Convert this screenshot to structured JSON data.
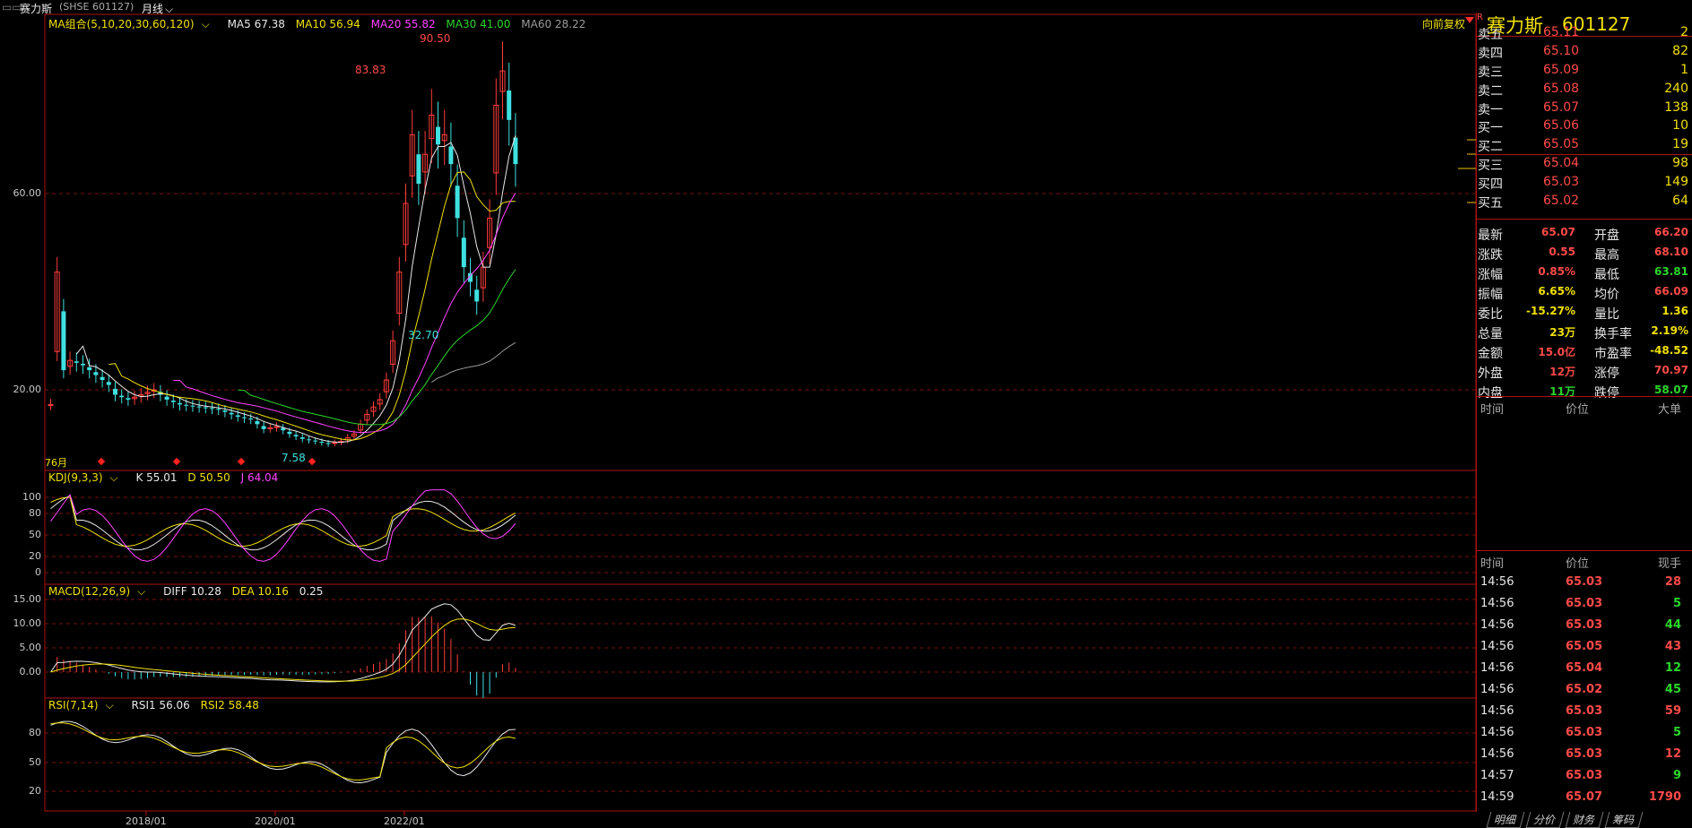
{
  "top_bar": {
    "stock_label": "赛力斯",
    "code_label": "(SHSE 601127)",
    "period": "月线"
  },
  "main_chart": {
    "ma_combo": "MA组合(5,10,20,30,60,120)",
    "ma5": "MA5 67.38",
    "ma10": "MA10 56.94",
    "ma20": "MA20 55.82",
    "ma30": "MA30 41.00",
    "ma60": "MA60 28.22",
    "adjust": "向前复权",
    "y_labels": [
      "60.00",
      "20.00"
    ],
    "high1": "83.83",
    "high2": "90.50",
    "low1": "7.58",
    "low2": "32.70",
    "months": "76月",
    "colors": {
      "ma5": "#e8e8e8",
      "ma10": "#f0e000",
      "ma20": "#ff44ff",
      "ma30": "#2bd62b",
      "ma60": "#9a9a9a",
      "up": "#ff3c3c",
      "down": "#3fe0e0"
    }
  },
  "kdj": {
    "title": "KDJ(9,3,3)",
    "k": "K 55.01",
    "d": "D 50.50",
    "j": "J 64.04",
    "y_labels": [
      "100",
      "80",
      "50",
      "20",
      "0"
    ]
  },
  "macd": {
    "title": "MACD(12,26,9)",
    "diff": "DIFF 10.28",
    "dea": "DEA 10.16",
    "macd": "0.25",
    "y_labels": [
      "15.00",
      "10.00",
      "5.00",
      "0.00"
    ]
  },
  "rsi": {
    "title": "RSI(7,14)",
    "rsi1": "RSI1 56.06",
    "rsi2": "RSI2 58.48",
    "y_labels": [
      "80",
      "50",
      "20"
    ]
  },
  "x_axis": [
    "2018/01",
    "2020/01",
    "2022/01"
  ],
  "quote": {
    "title": "赛力斯",
    "code": "601127",
    "r_badge": "R",
    "sell": [
      {
        "name": "卖五",
        "price": "65.11",
        "vol": "2"
      },
      {
        "name": "卖四",
        "price": "65.10",
        "vol": "82"
      },
      {
        "name": "卖三",
        "price": "65.09",
        "vol": "1"
      },
      {
        "name": "卖二",
        "price": "65.08",
        "vol": "240"
      },
      {
        "name": "卖一",
        "price": "65.07",
        "vol": "138"
      }
    ],
    "buy": [
      {
        "name": "买一",
        "price": "65.06",
        "vol": "10"
      },
      {
        "name": "买二",
        "price": "65.05",
        "vol": "19"
      },
      {
        "name": "买三",
        "price": "65.04",
        "vol": "98"
      },
      {
        "name": "买四",
        "price": "65.03",
        "vol": "149"
      },
      {
        "name": "买五",
        "price": "65.02",
        "vol": "64"
      }
    ],
    "stats": [
      {
        "l1": "最新",
        "v1": "65.07",
        "c1": "red",
        "l2": "开盘",
        "v2": "66.20",
        "c2": "red"
      },
      {
        "l1": "涨跌",
        "v1": "0.55",
        "c1": "red",
        "l2": "最高",
        "v2": "68.10",
        "c2": "red"
      },
      {
        "l1": "涨幅",
        "v1": "0.85%",
        "c1": "red",
        "l2": "最低",
        "v2": "63.81",
        "c2": "grn"
      },
      {
        "l1": "振幅",
        "v1": "6.65%",
        "c1": "yel",
        "l2": "均价",
        "v2": "66.09",
        "c2": "red"
      },
      {
        "l1": "委比",
        "v1": "-15.27%",
        "c1": "yel",
        "l2": "量比",
        "v2": "1.36",
        "c2": "yel"
      },
      {
        "l1": "总量",
        "v1": "23万",
        "c1": "yel",
        "l2": "换手率",
        "v2": "2.19%",
        "c2": "yel"
      },
      {
        "l1": "金额",
        "v1": "15.0亿",
        "c1": "red",
        "l2": "市盈率",
        "v2": "-48.52",
        "c2": "yel"
      },
      {
        "l1": "外盘",
        "v1": "12万",
        "c1": "red",
        "l2": "涨停",
        "v2": "70.97",
        "c2": "red"
      },
      {
        "l1": "内盘",
        "v1": "11万",
        "c1": "grn",
        "l2": "跌停",
        "v2": "58.07",
        "c2": "grn"
      }
    ],
    "big_header": {
      "time": "时间",
      "price": "价位",
      "vol": "大单"
    },
    "tick_header": {
      "time": "时间",
      "price": "价位",
      "vol": "现手"
    },
    "ticks": [
      {
        "time": "14:56",
        "price": "65.03",
        "vol": "28",
        "c": "red"
      },
      {
        "time": "14:56",
        "price": "65.03",
        "vol": "5",
        "c": "grn"
      },
      {
        "time": "14:56",
        "price": "65.03",
        "vol": "44",
        "c": "grn"
      },
      {
        "time": "14:56",
        "price": "65.05",
        "vol": "43",
        "c": "red"
      },
      {
        "time": "14:56",
        "price": "65.04",
        "vol": "12",
        "c": "grn"
      },
      {
        "time": "14:56",
        "price": "65.02",
        "vol": "45",
        "c": "grn"
      },
      {
        "time": "14:56",
        "price": "65.03",
        "vol": "59",
        "c": "red"
      },
      {
        "time": "14:56",
        "price": "65.03",
        "vol": "5",
        "c": "grn"
      },
      {
        "time": "14:56",
        "price": "65.03",
        "vol": "12",
        "c": "red"
      },
      {
        "time": "14:57",
        "price": "65.03",
        "vol": "9",
        "c": "grn"
      },
      {
        "time": "14:59",
        "price": "65.07",
        "vol": "1790",
        "c": "red"
      }
    ],
    "tabs": [
      "明细",
      "分价",
      "财务",
      "筹码"
    ]
  }
}
